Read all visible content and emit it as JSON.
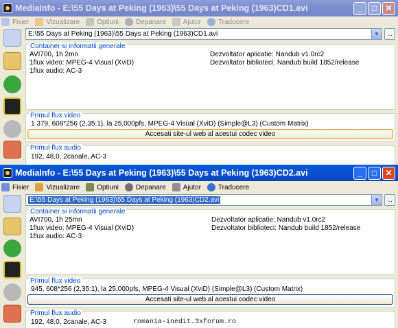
{
  "colors": {
    "accent": "#0046d5",
    "active_title": "#0a4fd1",
    "inactive_title": "#7c8ecf"
  },
  "window1": {
    "title": "MediaInfo - E:\\55 Days at Peking (1963)\\55 Days at Peking (1963)CD1.avi",
    "menu": [
      "Fisier",
      "Vizualizare",
      "Optiuni",
      "Depanare",
      "Ajutor",
      "Traducere"
    ],
    "path": "E:\\55 Days at Peking (1963)\\55 Days at Peking (1963)CD1.avi",
    "general": {
      "title": "Container si informatii generale",
      "l1": "AVI700, 1h 2mn",
      "l2": "1flux video: MPEG-4 Visual (XviD)",
      "l3": "1flux audio: AC-3",
      "r1": "Dezvoltator aplicatie: Nandub v1.0rc2",
      "r2": "Dezvoltator biblioteci: Nandub build 1852/release"
    },
    "video": {
      "title": "Primul flux video",
      "line": "1 379, 608*256 (2,35:1), la 25,000pfs, MPEG-4 Visual (XviD) (Simple@L3) (Custom Matrix)",
      "button": "Accesati site-ul web al acestui codec video"
    },
    "audio": {
      "title": "Primul flux audio",
      "line": "192, 48,0, 2canale, AC-3"
    }
  },
  "window2": {
    "title": "MediaInfo - E:\\55 Days at Peking (1963)\\55 Days at Peking (1963)CD2.avi",
    "menu": [
      "Fisier",
      "Vizualizare",
      "Optiuni",
      "Depanare",
      "Ajutor",
      "Traducere"
    ],
    "path": "E:\\55 Days at Peking (1963)\\55 Days at Peking (1963)CD2.avi",
    "general": {
      "title": "Container si informatii generale",
      "l1": "AVI700, 1h 25mn",
      "l2": "1flux video: MPEG-4 Visual (XviD)",
      "l3": "1flux audio: AC-3",
      "r1": "Dezvoltator aplicatie: Nandub v1.0rc2",
      "r2": "Dezvoltator biblioteci: Nandub build 1852/release"
    },
    "video": {
      "title": "Primul flux video",
      "line": "945, 608*256 (2,35:1), la 25,000pfs, MPEG-4 Visual (XviD) (Simple@L3) (Custom Matrix)",
      "button": "Accesati site-ul web al acestui codec video"
    },
    "audio": {
      "title": "Primul flux audio",
      "line": "192, 48,0, 2canale, AC-3"
    }
  },
  "toolbar_icons": [
    "open-file-icon",
    "open-folder-icon",
    "next-icon",
    "export-icon",
    "settings-icon",
    "edit-icon"
  ],
  "watermark": "romania-inedit.3xforum.ro"
}
